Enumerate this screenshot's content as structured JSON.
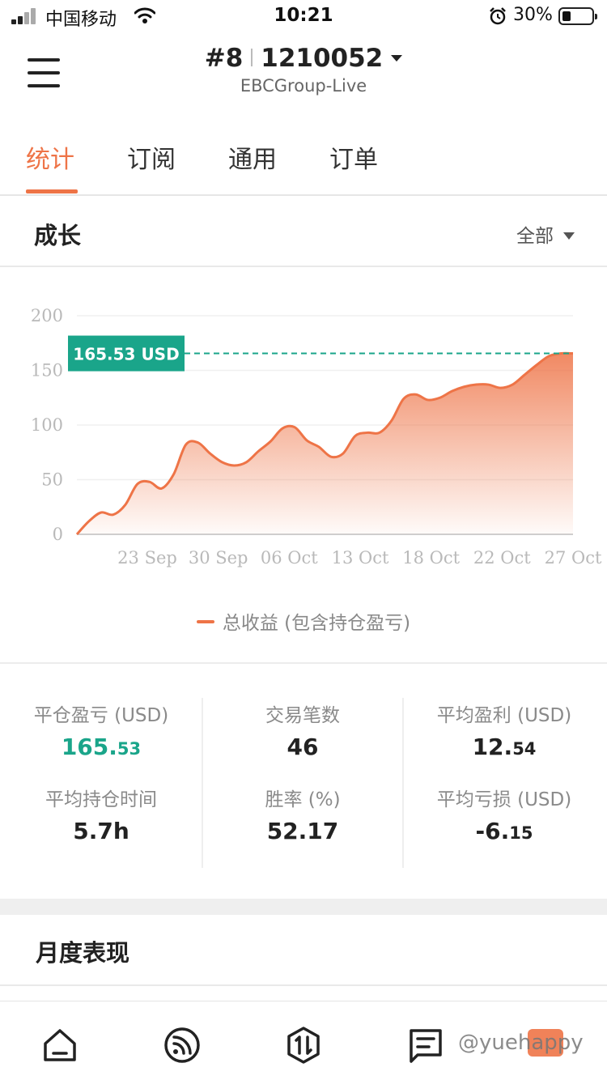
{
  "status_bar": {
    "carrier": "中国移动",
    "time": "10:21",
    "battery_percent": "30%"
  },
  "header": {
    "account_index": "#8",
    "account_number": "1210052",
    "server": "EBCGroup-Live"
  },
  "tabs": [
    {
      "label": "统计",
      "active": true
    },
    {
      "label": "订阅",
      "active": false
    },
    {
      "label": "通用",
      "active": false
    },
    {
      "label": "订单",
      "active": false
    }
  ],
  "growth": {
    "title": "成长",
    "filter_label": "全部",
    "current_value_label": "165.53 USD",
    "legend_label": "总收益 (包含持仓盈亏)"
  },
  "chart_data": {
    "type": "area",
    "ylim": [
      0,
      200
    ],
    "y_ticks": [
      0,
      50,
      100,
      150,
      200
    ],
    "x_tick_labels": [
      "23 Sep",
      "30 Sep",
      "06 Oct",
      "13 Oct",
      "18 Oct",
      "22 Oct",
      "27 Oct"
    ],
    "series": [
      {
        "name": "总收益 (包含持仓盈亏)",
        "values": [
          0,
          12,
          20,
          18,
          27,
          46,
          48,
          42,
          55,
          82,
          84,
          74,
          66,
          63,
          66,
          76,
          85,
          97,
          98,
          86,
          80,
          71,
          74,
          90,
          93,
          93,
          104,
          124,
          128,
          123,
          125,
          131,
          135,
          137,
          137,
          134,
          137,
          146,
          155,
          163,
          165.53,
          165.53
        ]
      }
    ],
    "reference_line": 165.53,
    "accent_color": "#ee7447",
    "reference_color": "#1aa58a"
  },
  "stats": {
    "closed_pnl": {
      "label": "平仓盈亏 (USD)",
      "int": "165.",
      "dec": "53"
    },
    "trades": {
      "label": "交易笔数",
      "value": "46"
    },
    "avg_profit": {
      "label": "平均盈利 (USD)",
      "int": "12.",
      "dec": "54"
    },
    "avg_hold": {
      "label": "平均持仓时间",
      "value": "5.7h"
    },
    "win_rate": {
      "label": "胜率 (%)",
      "value": "52.17"
    },
    "avg_loss": {
      "label": "平均亏损 (USD)",
      "int": "-6.",
      "dec": "15"
    }
  },
  "monthly": {
    "title": "月度表现"
  },
  "bottom_nav": {
    "icons": [
      "home-icon",
      "feed-icon",
      "trade-icon",
      "news-icon"
    ],
    "watermark": "@yuehappy"
  },
  "colors": {
    "accent": "#ee7447",
    "positive": "#1aa58a"
  }
}
